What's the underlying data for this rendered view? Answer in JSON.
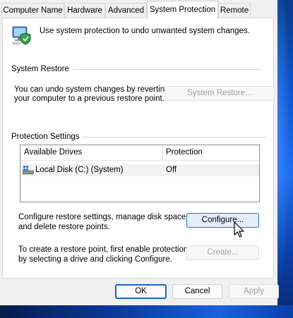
{
  "tabs": [
    {
      "label": "Computer Name",
      "active": false
    },
    {
      "label": "Hardware",
      "active": false
    },
    {
      "label": "Advanced",
      "active": false
    },
    {
      "label": "System Protection",
      "active": true
    },
    {
      "label": "Remote",
      "active": false
    }
  ],
  "intro": {
    "icon": "computer-shield-icon",
    "text": "Use system protection to undo unwanted system changes."
  },
  "system_restore": {
    "title": "System Restore",
    "description_line1": "You can undo system changes by reverting",
    "description_line2": "your computer to a previous restore point.",
    "button_label": "System Restore...",
    "button_enabled": false
  },
  "protection_settings": {
    "title": "Protection Settings",
    "columns": [
      "Available Drives",
      "Protection"
    ],
    "rows": [
      {
        "drive": "Local Disk (C:) (System)",
        "protection": "Off",
        "icon": "drive-icon"
      }
    ],
    "configure_line1": "Configure restore settings, manage disk space,",
    "configure_line2": "and delete restore points.",
    "configure_label": "Configure...",
    "create_line1": "To create a restore point, first enable protection",
    "create_line2": "by selecting a drive and clicking Configure.",
    "create_label": "Create...",
    "create_enabled": false
  },
  "footer": {
    "ok_label": "OK",
    "cancel_label": "Cancel",
    "apply_label": "Apply",
    "apply_enabled": false
  },
  "colors": {
    "accent": "#1a64c8",
    "disabled_text": "#a0a0a0"
  }
}
